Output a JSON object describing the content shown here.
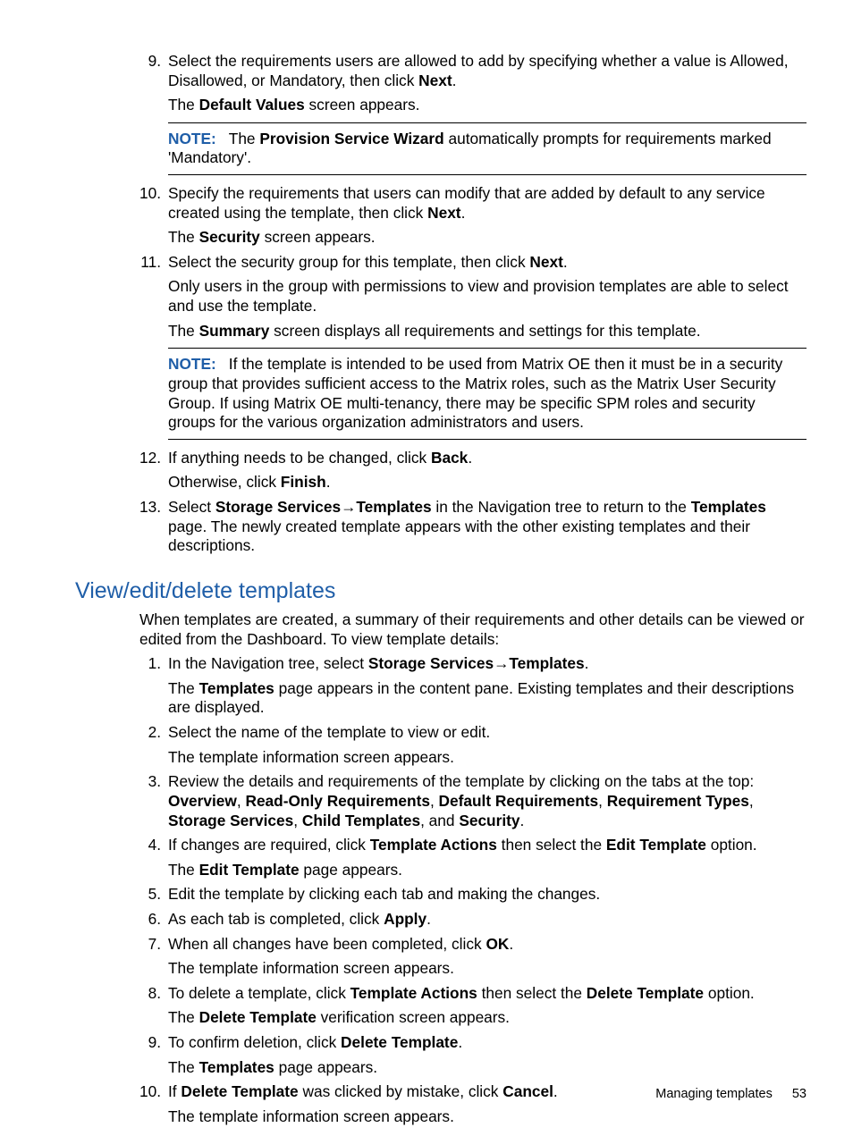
{
  "list1": {
    "i9": {
      "num": "9.",
      "p1a": "Select the requirements users are allowed to add by specifying whether a value is Allowed, Disallowed, or Mandatory, then click ",
      "p1b": "Next",
      "p1c": ".",
      "p2a": "The ",
      "p2b": "Default Values",
      "p2c": " screen appears.",
      "noteLabel": "NOTE:",
      "note_a": "The ",
      "note_b": "Provision Service Wizard",
      "note_c": " automatically prompts for requirements marked 'Mandatory'."
    },
    "i10": {
      "num": "10.",
      "p1a": "Specify the requirements that users can modify that are added by default to any service created using the template, then click ",
      "p1b": "Next",
      "p1c": ".",
      "p2a": "The ",
      "p2b": "Security",
      "p2c": " screen appears."
    },
    "i11": {
      "num": "11.",
      "p1a": "Select the security group for this template, then click ",
      "p1b": "Next",
      "p1c": ".",
      "p2": "Only users in the group with permissions to view and provision templates are able to select and use the template.",
      "p3a": "The ",
      "p3b": "Summary",
      "p3c": " screen displays all requirements and settings for this template.",
      "noteLabel": "NOTE:",
      "note": "If the template is intended to be used from Matrix OE then it must be in a security group that provides sufficient access to the Matrix roles, such as the Matrix User Security Group. If using Matrix OE multi-tenancy, there may be specific SPM roles and security groups for the various organization administrators and users."
    },
    "i12": {
      "num": "12.",
      "p1a": "If anything needs to be changed, click ",
      "p1b": "Back",
      "p1c": ".",
      "p2a": "Otherwise, click ",
      "p2b": "Finish",
      "p2c": "."
    },
    "i13": {
      "num": "13.",
      "p1a": "Select ",
      "p1b": "Storage Services",
      "p1c": "→",
      "p1d": "Templates",
      "p1e": " in the Navigation tree to return to the ",
      "p1f": "Templates",
      "p1g": " page. The newly created template appears with the other existing templates and their descriptions."
    }
  },
  "sectionTitle": "View/edit/delete templates",
  "intro": "When templates are created, a summary of their requirements and other details can be viewed or edited from the Dashboard. To view template details:",
  "list2": {
    "i1": {
      "num": "1.",
      "p1a": "In the Navigation tree, select ",
      "p1b": "Storage Services",
      "p1c": "→",
      "p1d": "Templates",
      "p1e": ".",
      "p2a": "The ",
      "p2b": "Templates",
      "p2c": " page appears in the content pane. Existing templates and their descriptions are displayed."
    },
    "i2": {
      "num": "2.",
      "p1": "Select the name of the template to view or edit.",
      "p2": "The template information screen appears."
    },
    "i3": {
      "num": "3.",
      "p1a": "Review the details and requirements of the template by clicking on the tabs at the top: ",
      "b1": "Overview",
      "s1": ", ",
      "b2": "Read-Only Requirements",
      "s2": ", ",
      "b3": "Default Requirements",
      "s3": ", ",
      "b4": "Requirement Types",
      "s4": ", ",
      "b5": "Storage Services",
      "s5": ", ",
      "b6": "Child Templates",
      "s6": ", and ",
      "b7": "Security",
      "s7": "."
    },
    "i4": {
      "num": "4.",
      "p1a": "If changes are required, click ",
      "p1b": "Template Actions",
      "p1c": " then select the ",
      "p1d": "Edit Template",
      "p1e": " option.",
      "p2a": "The ",
      "p2b": "Edit Template",
      "p2c": " page appears."
    },
    "i5": {
      "num": "5.",
      "p1": "Edit the template by clicking each tab and making the changes."
    },
    "i6": {
      "num": "6.",
      "p1a": "As each tab is completed, click ",
      "p1b": "Apply",
      "p1c": "."
    },
    "i7": {
      "num": "7.",
      "p1a": "When all changes have been completed, click ",
      "p1b": "OK",
      "p1c": ".",
      "p2": "The template information screen appears."
    },
    "i8": {
      "num": "8.",
      "p1a": "To delete a template, click ",
      "p1b": "Template Actions",
      "p1c": " then select the ",
      "p1d": "Delete Template",
      "p1e": " option.",
      "p2a": "The ",
      "p2b": "Delete Template",
      "p2c": " verification screen appears."
    },
    "i9": {
      "num": "9.",
      "p1a": "To confirm deletion, click ",
      "p1b": "Delete Template",
      "p1c": ".",
      "p2a": "The ",
      "p2b": "Templates",
      "p2c": " page appears."
    },
    "i10": {
      "num": "10.",
      "p1a": "If ",
      "p1b": "Delete Template",
      "p1c": " was clicked by mistake, click ",
      "p1d": "Cancel",
      "p1e": ".",
      "p2": "The template information screen appears."
    }
  },
  "footer": {
    "text": "Managing templates",
    "page": "53"
  }
}
